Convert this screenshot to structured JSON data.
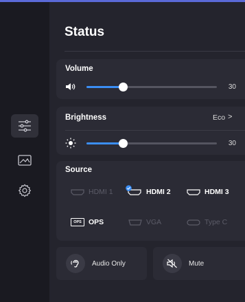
{
  "header": {
    "title": "Status"
  },
  "volume": {
    "label": "Volume",
    "value": "30",
    "level": 0.3
  },
  "brightness": {
    "label": "Brightness",
    "mode": "Eco",
    "chevron": ">",
    "value": "30",
    "level": 0.3
  },
  "source": {
    "label": "Source",
    "items": [
      {
        "label": "HDMI 1",
        "state": "disabled",
        "icon": "hdmi-icon"
      },
      {
        "label": "HDMI 2",
        "state": "selected",
        "icon": "hdmi-icon"
      },
      {
        "label": "HDMI 3",
        "state": "enabled",
        "icon": "hdmi-icon"
      },
      {
        "label": "OPS",
        "state": "enabled",
        "icon": "ops-icon",
        "badge": "OPS"
      },
      {
        "label": "VGA",
        "state": "disabled",
        "icon": "vga-icon"
      },
      {
        "label": "Type C",
        "state": "disabled",
        "icon": "type-c-icon"
      }
    ]
  },
  "actions": {
    "audio_only": "Audio Only",
    "mute": "Mute"
  },
  "sidebar": {
    "items": [
      {
        "icon": "sliders-icon",
        "active": true
      },
      {
        "icon": "image-icon",
        "active": false
      },
      {
        "icon": "settings-icon",
        "active": false
      }
    ]
  },
  "colors": {
    "accent": "#3b8ef5",
    "background": "#1b1b23",
    "panel": "#2b2b35"
  }
}
